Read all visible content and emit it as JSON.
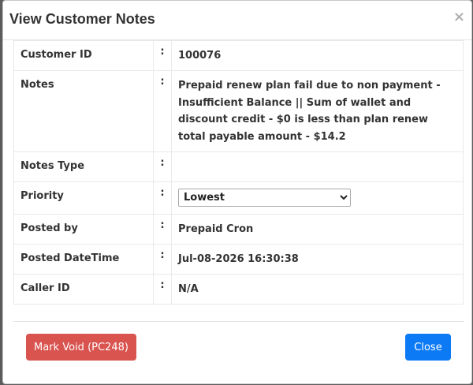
{
  "modal": {
    "title": "View Customer Notes",
    "close_glyph": "×"
  },
  "rows": [
    {
      "label": "Customer ID",
      "colon": ":",
      "value": "100076"
    },
    {
      "label": "Notes",
      "colon": ":",
      "value": "Prepaid renew plan fail due to non payment - Insufficient Balance || Sum of wallet and discount credit - $0 is less than plan renew total payable amount - $14.2"
    },
    {
      "label": "Notes Type",
      "colon": ":",
      "value": ""
    },
    {
      "label": "Priority",
      "colon": ":",
      "value": "Lowest"
    },
    {
      "label": "Posted by",
      "colon": ":",
      "value": "Prepaid Cron"
    },
    {
      "label": "Posted DateTime",
      "colon": ":",
      "value": "Jul-08-2026 16:30:38"
    },
    {
      "label": "Caller ID",
      "colon": ":",
      "value": "N/A"
    }
  ],
  "priority_options": [
    "Lowest"
  ],
  "buttons": {
    "mark_void": "Mark Void (PC248)",
    "close": "Close"
  },
  "colors": {
    "danger": "#d9534f",
    "primary": "#0d7af5",
    "text": "#333333"
  }
}
